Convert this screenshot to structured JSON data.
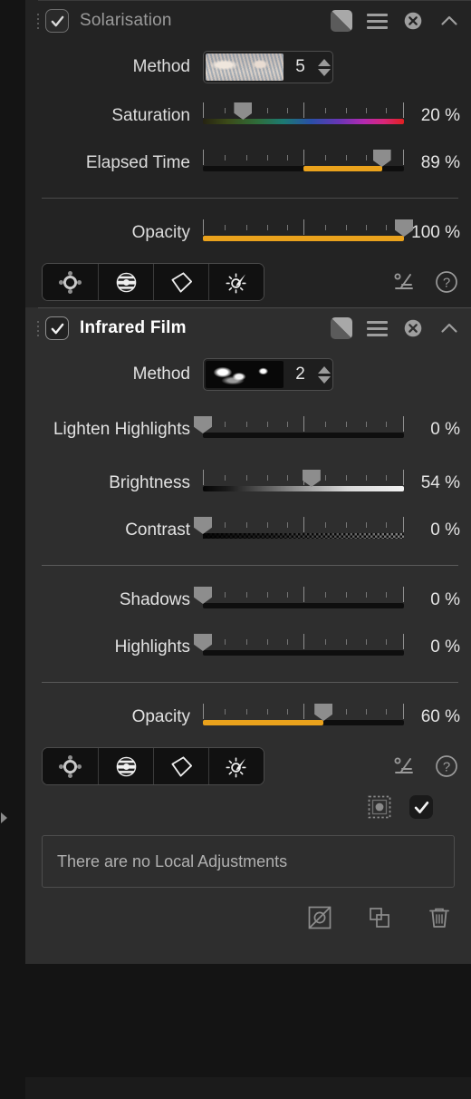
{
  "panels": [
    {
      "name": "Solarisation",
      "enabled": true,
      "active": false,
      "method": {
        "label": "Method",
        "value": "5"
      },
      "sliders": [
        {
          "label": "Saturation",
          "value": "20 %",
          "pct": 20,
          "style": "saturation",
          "origin": "left"
        },
        {
          "label": "Elapsed Time",
          "value": "89 %",
          "pct": 89,
          "style": "plain",
          "origin": "center"
        }
      ],
      "opacity": {
        "label": "Opacity",
        "value": "100 %",
        "pct": 100,
        "origin": "left"
      }
    },
    {
      "name": "Infrared Film",
      "enabled": true,
      "active": true,
      "method": {
        "label": "Method",
        "value": "2"
      },
      "sliders": [
        {
          "label": "Lighten Highlights",
          "value": "0 %",
          "pct": 0,
          "style": "plain",
          "origin": "left"
        },
        {
          "label": "Brightness",
          "value": "54 %",
          "pct": 54,
          "style": "brightness",
          "origin": "left"
        },
        {
          "label": "Contrast",
          "value": "0 %",
          "pct": 0,
          "style": "contrast",
          "origin": "left"
        }
      ],
      "sliders2": [
        {
          "label": "Shadows",
          "value": "0 %",
          "pct": 0,
          "style": "plain",
          "origin": "left"
        },
        {
          "label": "Highlights",
          "value": "0 %",
          "pct": 0,
          "style": "plain",
          "origin": "left"
        }
      ],
      "opacity": {
        "label": "Opacity",
        "value": "60 %",
        "pct": 60,
        "origin": "left"
      }
    }
  ],
  "tools": {
    "buttons": [
      "control-point",
      "graduated-filter",
      "polygon-selection",
      "brightness-brush"
    ],
    "curves_label": "curves",
    "help_label": "?"
  },
  "local_adjustments": {
    "empty_text": "There are no Local Adjustments"
  },
  "colors": {
    "accent": "#eaa21c",
    "panel_active": "#2e2e2e",
    "panel_inactive": "#232323",
    "handle": "#8d8d8d"
  }
}
